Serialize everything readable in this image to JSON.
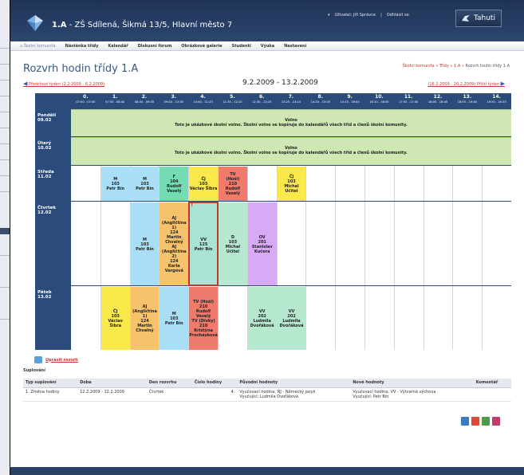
{
  "header": {
    "title_bold": "1.A",
    "title_rest": "- ZŠ Sdílená, Šikmá 13/5, Hlavní město 7",
    "user_label": "Uživatel: Jiří Správce",
    "logout": "Odhlásit se",
    "brand": "Tahuti"
  },
  "nav": {
    "home": "Školní komunita",
    "items": [
      "Nástěnka třídy",
      "Kalendář",
      "Diskusní fórum",
      "Obrázkové galerie",
      "Studenti",
      "Výuka",
      "Nastavení"
    ]
  },
  "page_title": "Rozvrh hodin třídy 1.A",
  "breadcrumb": {
    "items": [
      "Školní komunita",
      "Třídy",
      "1.A"
    ],
    "current": "Rozvrh hodin třídy 1.A"
  },
  "week": {
    "prev": "Předchozí týden (2.2.2009 - 6.2.2009)",
    "current": "9.2.2009 - 13.2.2009",
    "next": "(16.2.2009 - 20.2.2009) Příští týden"
  },
  "hours": [
    {
      "n": "0.",
      "t": "07:00 - 07:45"
    },
    {
      "n": "1.",
      "t": "07:55 - 08:40"
    },
    {
      "n": "2.",
      "t": "08:50 - 09:35"
    },
    {
      "n": "3.",
      "t": "09:45 - 10:30"
    },
    {
      "n": "4.",
      "t": "10:40 - 11:25"
    },
    {
      "n": "5.",
      "t": "11:35 - 12:20"
    },
    {
      "n": "6.",
      "t": "12:30 - 13:15"
    },
    {
      "n": "7.",
      "t": "13:25 - 14:10"
    },
    {
      "n": "8.",
      "t": "14:20 - 15:05"
    },
    {
      "n": "9.",
      "t": "15:15 - 16:00"
    },
    {
      "n": "10.",
      "t": "16:10 - 16:55"
    },
    {
      "n": "11.",
      "t": "17:05 - 17:50"
    },
    {
      "n": "12.",
      "t": "18:00 - 18:45"
    },
    {
      "n": "13.",
      "t": "18:55 - 19:40"
    },
    {
      "n": "14.",
      "t": "19:50 - 20:35"
    }
  ],
  "days": [
    {
      "name": "Pondělí",
      "date": "09.02"
    },
    {
      "name": "Úterý",
      "date": "10.02"
    },
    {
      "name": "Středa",
      "date": "11.02"
    },
    {
      "name": "Čtvrtek",
      "date": "12.02"
    },
    {
      "name": "Pátek",
      "date": "13.02"
    }
  ],
  "free_day": {
    "title": "Volno",
    "text": "Toto je ukázkové školní volno. Školní volno se kopíruje do kalendářů všech tříd a členů školní komunity."
  },
  "lessons": {
    "wed": [
      {
        "color": "blue",
        "lines": [
          "M",
          "103",
          "Petr Bín"
        ]
      },
      {
        "color": "blue",
        "lines": [
          "M",
          "103",
          "Petr Bín"
        ]
      },
      {
        "color": "green",
        "lines": [
          "F",
          "104",
          "Rudolf",
          "Veselý"
        ]
      },
      {
        "color": "yellow",
        "lines": [
          "ČJ",
          "103",
          "Václav Šibra"
        ]
      },
      {
        "color": "red",
        "lines": [
          "TV",
          "(Hoši)",
          "210",
          "Rudolf",
          "Veselý"
        ]
      },
      {
        "color": "yellow",
        "lines": [
          "ČJ",
          "103",
          "Michal",
          "Učitel"
        ]
      }
    ],
    "thu": [
      {
        "color": "blue",
        "lines": [
          "M",
          "103",
          "Petr Bín"
        ]
      },
      {
        "color": "orange",
        "lines": [
          "AJ",
          "(Angličtina",
          "1)",
          "124",
          "Martin",
          "Chvalný",
          "AJ",
          "(Angličtina",
          "2)",
          "124",
          "Karla",
          "Vargová"
        ]
      },
      {
        "color": "teal",
        "lines": [
          "VV",
          "125",
          "Petr Bín"
        ]
      },
      {
        "color": "mint",
        "lines": [
          "D",
          "103",
          "Michal",
          "Učitel"
        ]
      },
      {
        "color": "purple",
        "lines": [
          "OV",
          "201",
          "Stanislav",
          "Kučera"
        ]
      }
    ],
    "fri": [
      {
        "color": "yellow",
        "lines": [
          "ČJ",
          "103",
          "Václav",
          "Šibra"
        ]
      },
      {
        "color": "orange",
        "lines": [
          "AJ",
          "(Angličtina",
          "1)",
          "124",
          "Martin",
          "Chvalný"
        ]
      },
      {
        "color": "blue",
        "lines": [
          "M",
          "103",
          "Petr Bín"
        ]
      },
      {
        "color": "red",
        "lines": [
          "TV (Hoši)",
          "210",
          "Rudolf",
          "Veselý",
          "TV (Dívky)",
          "210",
          "Kristýna",
          "Procházková"
        ]
      },
      {
        "color": "mint",
        "lines": [
          "VV",
          "202",
          "Ludmila",
          "Dvořáková"
        ]
      },
      {
        "color": "mint",
        "lines": [
          "VV",
          "202",
          "Ludmila",
          "Dvořáková"
        ]
      }
    ],
    "change_mark": "!"
  },
  "print_link": "Upravit rozvrh",
  "substitutions": {
    "label": "Suplování",
    "headers": [
      "Typ suplování",
      "Doba",
      "Den rozvrhu",
      "Číslo hodiny",
      "Původní hodnoty",
      "Nové hodnoty",
      "Komentář"
    ],
    "rows": [
      {
        "no": "1.",
        "type": "Změna hodiny",
        "period": "12.2.2009 - 12.2.2009",
        "day": "Čtvrtek",
        "hour": "4.",
        "orig1": "Vyučovací hodina: NJ - Německý jazyk",
        "orig2": "Vyučující: Ludmila Dvořáková",
        "new1": "Vyučovací hodina: VV - Výtvarná výchova",
        "new2": "Vyučující: Petr Bín",
        "comment": ""
      }
    ]
  },
  "colors": {
    "header": "#1f3356",
    "accent_red": "#c0392b",
    "free_day": "#cfe7b3",
    "grid_header": "#2b4b7a"
  }
}
